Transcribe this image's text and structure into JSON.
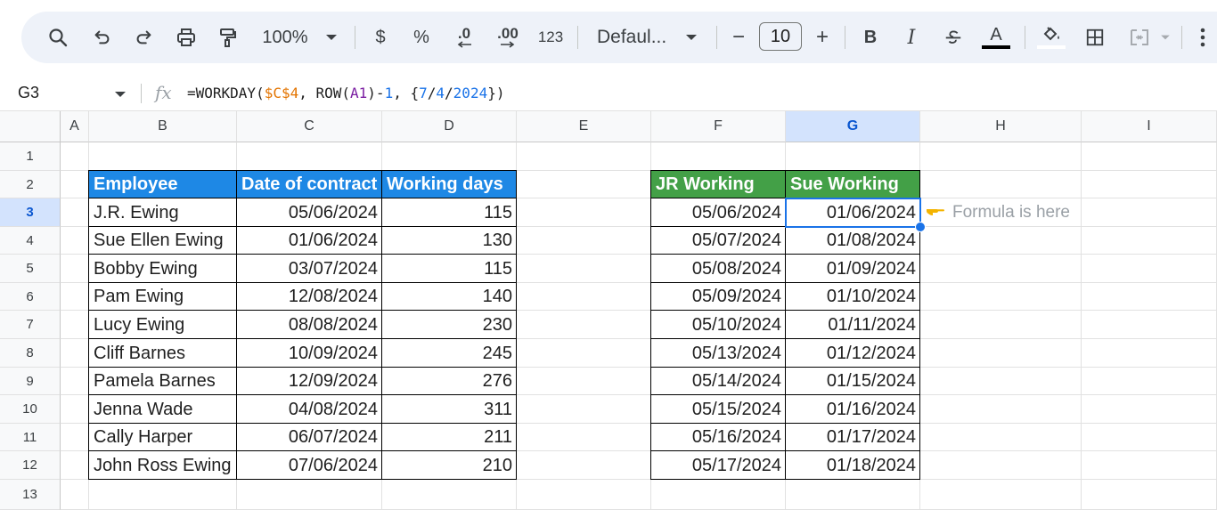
{
  "toolbar": {
    "zoom": "100%",
    "currency": "$",
    "percent": "%",
    "dec_decrease": ".0",
    "dec_increase": ".00",
    "number_format": "123",
    "font": "Defaul...",
    "font_size": "10",
    "minus": "−",
    "plus": "+",
    "bold": "B",
    "italic": "I",
    "text_color_label": "A"
  },
  "formula_bar": {
    "cell_ref": "G3",
    "fx": "fx",
    "formula_parts": [
      "=WORKDAY(",
      "$C$4",
      ", ROW(",
      "A1",
      ")-",
      "1",
      ", {",
      "7",
      "/",
      "4",
      "/",
      "2024",
      "})"
    ]
  },
  "columns": [
    "A",
    "B",
    "C",
    "D",
    "E",
    "F",
    "G",
    "H",
    "I"
  ],
  "selected_column": "G",
  "rows": [
    "1",
    "2",
    "3",
    "4",
    "5",
    "6",
    "7",
    "8",
    "9",
    "10",
    "11",
    "12",
    "13"
  ],
  "selected_row": "3",
  "employee_table": {
    "headers": [
      "Employee",
      "Date of contract",
      "Working days"
    ],
    "rows": [
      [
        "J.R. Ewing",
        "05/06/2024",
        "115"
      ],
      [
        "Sue Ellen Ewing",
        "01/06/2024",
        "130"
      ],
      [
        "Bobby Ewing",
        "03/07/2024",
        "115"
      ],
      [
        "Pam Ewing",
        "12/08/2024",
        "140"
      ],
      [
        "Lucy Ewing",
        "08/08/2024",
        "230"
      ],
      [
        "Cliff Barnes",
        "10/09/2024",
        "245"
      ],
      [
        "Pamela Barnes",
        "12/09/2024",
        "276"
      ],
      [
        "Jenna Wade",
        "04/08/2024",
        "311"
      ],
      [
        "Cally Harper",
        "06/07/2024",
        "211"
      ],
      [
        "John Ross Ewing",
        "07/06/2024",
        "210"
      ]
    ]
  },
  "working_table": {
    "headers": [
      "JR Working",
      "Sue Working"
    ],
    "rows": [
      [
        "05/06/2024",
        "01/06/2024"
      ],
      [
        "05/07/2024",
        "01/08/2024"
      ],
      [
        "05/08/2024",
        "01/09/2024"
      ],
      [
        "05/09/2024",
        "01/10/2024"
      ],
      [
        "05/10/2024",
        "01/11/2024"
      ],
      [
        "05/13/2024",
        "01/12/2024"
      ],
      [
        "05/14/2024",
        "01/15/2024"
      ],
      [
        "05/15/2024",
        "01/16/2024"
      ],
      [
        "05/16/2024",
        "01/17/2024"
      ],
      [
        "05/17/2024",
        "01/18/2024"
      ]
    ]
  },
  "note": "Formula is here",
  "colors": {
    "blue_header": "#1e88e5",
    "green_header": "#43a047",
    "selection": "#1a73e8"
  }
}
